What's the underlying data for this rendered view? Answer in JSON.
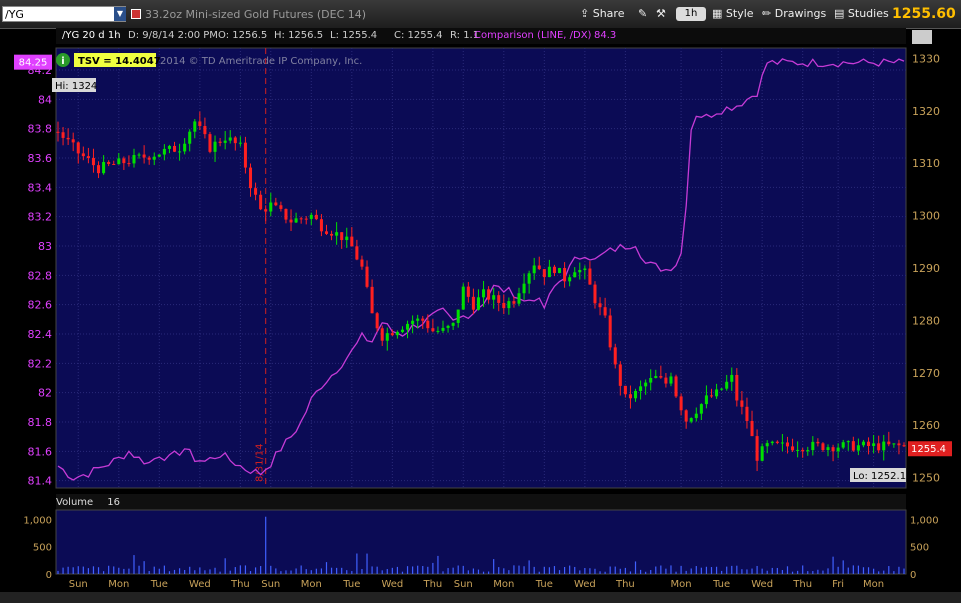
{
  "toolbar": {
    "symbol": "/YG",
    "instrument_name": "33.2oz Mini-sized Gold Futures (DEC 14)",
    "share_label": "Share",
    "interval": "1h",
    "style_label": "Style",
    "drawings_label": "Drawings",
    "studies_label": "Studies",
    "last_price": "1255.60"
  },
  "infobar": {
    "period": "/YG 20 d 1h",
    "date": "D: 9/8/14 2:00 PM",
    "open": "O: 1256.5",
    "high": "H: 1256.5",
    "low": "L: 1255.4",
    "close": "C: 1255.4",
    "range": "R: 1.1",
    "comparison": "Comparison (LINE, /DX)",
    "comparison_value": "84.3"
  },
  "watermark": "2014 © TD Ameritrade IP Company, Inc.",
  "tsv_label": "TSV",
  "tsv_value": "= 14.4047",
  "colors": {
    "background": "#0b0b55",
    "up": "#00e000",
    "down": "#ff2020",
    "comparison": "#c63bd6",
    "axis_text": "#c8a25a",
    "left_axis_text": "#e040ff",
    "volume": "#4060ff"
  },
  "chart_data": {
    "type": "candlestick",
    "instrument": "/YG",
    "comparison": "/DX",
    "left_axis": {
      "ylim": [
        81.35,
        84.35
      ],
      "ticks": [
        81.4,
        81.6,
        81.8,
        82,
        82.2,
        82.4,
        82.6,
        82.8,
        83,
        83.2,
        83.4,
        83.6,
        83.8,
        84,
        84.2
      ],
      "current_label": "84.25"
    },
    "right_axis": {
      "ylim": [
        1248,
        1332
      ],
      "ticks": [
        1250,
        1260,
        1270,
        1280,
        1290,
        1300,
        1310,
        1320,
        1330
      ],
      "current_label": "1255.4"
    },
    "x_ticks": [
      "Sun",
      "Mon",
      "Tue",
      "Wed",
      "Thu",
      "Sun",
      "Mon",
      "Tue",
      "Wed",
      "Thu",
      "Sun",
      "Mon",
      "Tue",
      "Wed",
      "Thu",
      "Mon",
      "Tue",
      "Wed",
      "Thu",
      "Fri",
      "Mon"
    ],
    "x_tick_bar_index": [
      4,
      12,
      20,
      28,
      36,
      42,
      50,
      58,
      66,
      74,
      80,
      88,
      96,
      104,
      112,
      123,
      131,
      139,
      147,
      154,
      161
    ],
    "bar_count": 168,
    "vertical_marker": {
      "label": "8/31/14",
      "bar_index": 41
    },
    "high_label": "Hi: 1324",
    "low_label": "Lo: 1252.1",
    "gold_close_anchors": [
      [
        0,
        1316
      ],
      [
        4,
        1312
      ],
      [
        8,
        1309
      ],
      [
        12,
        1310
      ],
      [
        16,
        1311
      ],
      [
        20,
        1312
      ],
      [
        24,
        1313
      ],
      [
        27,
        1318
      ],
      [
        30,
        1313
      ],
      [
        33,
        1315
      ],
      [
        36,
        1313
      ],
      [
        38,
        1306
      ],
      [
        40,
        1301
      ],
      [
        42,
        1302
      ],
      [
        46,
        1299
      ],
      [
        50,
        1300
      ],
      [
        52,
        1298
      ],
      [
        56,
        1296
      ],
      [
        58,
        1294
      ],
      [
        60,
        1290
      ],
      [
        62,
        1281
      ],
      [
        64,
        1277
      ],
      [
        66,
        1278
      ],
      [
        68,
        1279
      ],
      [
        70,
        1280
      ],
      [
        72,
        1280
      ],
      [
        74,
        1278
      ],
      [
        76,
        1278
      ],
      [
        78,
        1279
      ],
      [
        80,
        1286
      ],
      [
        82,
        1283
      ],
      [
        84,
        1285
      ],
      [
        86,
        1284
      ],
      [
        88,
        1283
      ],
      [
        90,
        1284
      ],
      [
        92,
        1288
      ],
      [
        94,
        1291
      ],
      [
        96,
        1289
      ],
      [
        98,
        1290
      ],
      [
        100,
        1288
      ],
      [
        102,
        1290
      ],
      [
        104,
        1289
      ],
      [
        106,
        1284
      ],
      [
        108,
        1280
      ],
      [
        110,
        1271
      ],
      [
        112,
        1265
      ],
      [
        114,
        1266
      ],
      [
        116,
        1268
      ],
      [
        118,
        1269
      ],
      [
        120,
        1268
      ],
      [
        121,
        1270
      ],
      [
        122,
        1266
      ],
      [
        124,
        1261
      ],
      [
        126,
        1263
      ],
      [
        128,
        1265
      ],
      [
        130,
        1266
      ],
      [
        132,
        1268
      ],
      [
        133,
        1269
      ],
      [
        134,
        1265
      ],
      [
        136,
        1261
      ],
      [
        138,
        1254
      ],
      [
        140,
        1256
      ]
    ],
    "dx_anchors": [
      [
        0,
        81.5
      ],
      [
        3,
        81.42
      ],
      [
        6,
        81.45
      ],
      [
        9,
        81.5
      ],
      [
        12,
        81.55
      ],
      [
        14,
        81.6
      ],
      [
        16,
        81.55
      ],
      [
        18,
        81.52
      ],
      [
        20,
        81.58
      ],
      [
        22,
        81.55
      ],
      [
        25,
        81.62
      ],
      [
        27,
        81.55
      ],
      [
        29,
        81.53
      ],
      [
        32,
        81.58
      ],
      [
        35,
        81.52
      ],
      [
        37,
        81.48
      ],
      [
        40,
        81.45
      ],
      [
        42,
        81.52
      ],
      [
        44,
        81.62
      ],
      [
        46,
        81.7
      ],
      [
        48,
        81.8
      ],
      [
        50,
        81.95
      ],
      [
        52,
        82.05
      ],
      [
        54,
        82.12
      ],
      [
        56,
        82.2
      ],
      [
        58,
        82.28
      ],
      [
        60,
        82.38
      ],
      [
        62,
        82.35
      ],
      [
        64,
        82.48
      ],
      [
        66,
        82.42
      ],
      [
        68,
        82.4
      ],
      [
        70,
        82.45
      ],
      [
        72,
        82.48
      ],
      [
        74,
        82.52
      ],
      [
        76,
        82.55
      ],
      [
        78,
        82.48
      ],
      [
        80,
        82.52
      ],
      [
        82,
        82.55
      ],
      [
        84,
        82.62
      ],
      [
        86,
        82.72
      ],
      [
        88,
        82.7
      ],
      [
        90,
        82.68
      ],
      [
        92,
        82.62
      ],
      [
        94,
        82.65
      ],
      [
        96,
        82.58
      ],
      [
        98,
        82.72
      ],
      [
        100,
        82.8
      ],
      [
        102,
        82.9
      ],
      [
        104,
        82.95
      ],
      [
        106,
        82.9
      ],
      [
        108,
        82.95
      ],
      [
        110,
        82.98
      ],
      [
        112,
        83.0
      ],
      [
        114,
        83.02
      ],
      [
        116,
        82.88
      ],
      [
        118,
        82.86
      ],
      [
        120,
        82.84
      ],
      [
        122,
        82.88
      ],
      [
        123,
        82.95
      ],
      [
        124,
        83.3
      ],
      [
        125,
        83.8
      ],
      [
        126,
        83.9
      ],
      [
        128,
        83.88
      ],
      [
        130,
        83.92
      ],
      [
        132,
        83.94
      ],
      [
        134,
        83.96
      ],
      [
        136,
        84.0
      ],
      [
        138,
        84.05
      ],
      [
        140,
        84.25
      ]
    ],
    "volume": {
      "ylim": [
        0,
        1100
      ],
      "ticks": [
        0,
        500,
        1000
      ],
      "tick_labels": [
        "0",
        "500",
        "1,000"
      ],
      "label": "Volume",
      "current": "16"
    }
  }
}
